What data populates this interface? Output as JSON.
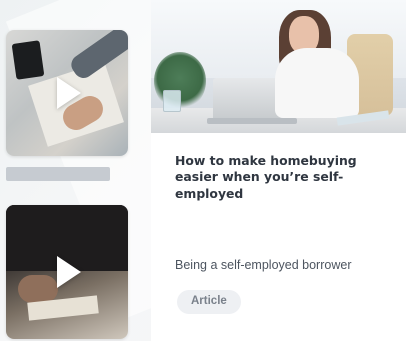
{
  "feature": {
    "title": "How to make homebuying easier when you’re self-employed",
    "subtitle": "Being a self-employed borrower",
    "badge": "Article"
  },
  "icons": {
    "play": "play-icon"
  },
  "colors": {
    "title": "#2f3640",
    "subtitle": "#4d5560",
    "badge_background": "#eef0f3",
    "badge_text": "#7a818b",
    "placeholder_bar": "#c6cbd1"
  }
}
